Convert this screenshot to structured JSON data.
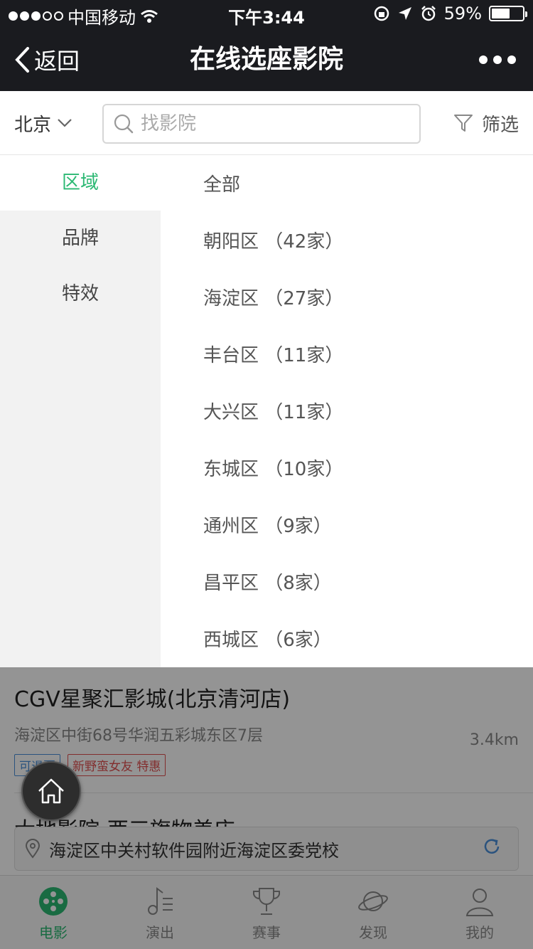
{
  "status_bar": {
    "carrier": "中国移动",
    "time": "下午3:44",
    "battery_text": "59%",
    "battery_level": 0.59,
    "signal_bars": 3
  },
  "nav": {
    "back_label": "返回",
    "title": "在线选座影院"
  },
  "search": {
    "city": "北京",
    "placeholder": "找影院",
    "filter_label": "筛选"
  },
  "filter_panel": {
    "categories": [
      {
        "label": "区域",
        "active": true
      },
      {
        "label": "品牌",
        "active": false
      },
      {
        "label": "特效",
        "active": false
      }
    ],
    "options": [
      "全部",
      "朝阳区 （42家）",
      "海淀区 （27家）",
      "丰台区 （11家）",
      "大兴区 （11家）",
      "东城区 （10家）",
      "通州区 （9家）",
      "昌平区 （8家）",
      "西城区 （6家）"
    ]
  },
  "cinemas": [
    {
      "name": "CGV星聚汇影城(北京清河店)",
      "address": "海淀区中街68号华润五彩城东区7层",
      "distance": "3.4km",
      "tags": [
        "可退票",
        "新野蛮女友 特惠"
      ]
    },
    {
      "name": "大地影院-西三旗物美店"
    }
  ],
  "location": {
    "text": "海淀区中关村软件园附近海淀区委党校"
  },
  "tabbar": {
    "tabs": [
      {
        "label": "电影",
        "icon": "film-reel-icon",
        "active": true
      },
      {
        "label": "演出",
        "icon": "music-note-icon",
        "active": false
      },
      {
        "label": "赛事",
        "icon": "trophy-icon",
        "active": false
      },
      {
        "label": "发现",
        "icon": "planet-icon",
        "active": false
      },
      {
        "label": "我的",
        "icon": "user-icon",
        "active": false
      }
    ]
  },
  "colors": {
    "accent": "#2bb873",
    "navbar": "#1a1b1f",
    "tag_blue": "#4a90d9",
    "tag_red": "#e05050"
  }
}
